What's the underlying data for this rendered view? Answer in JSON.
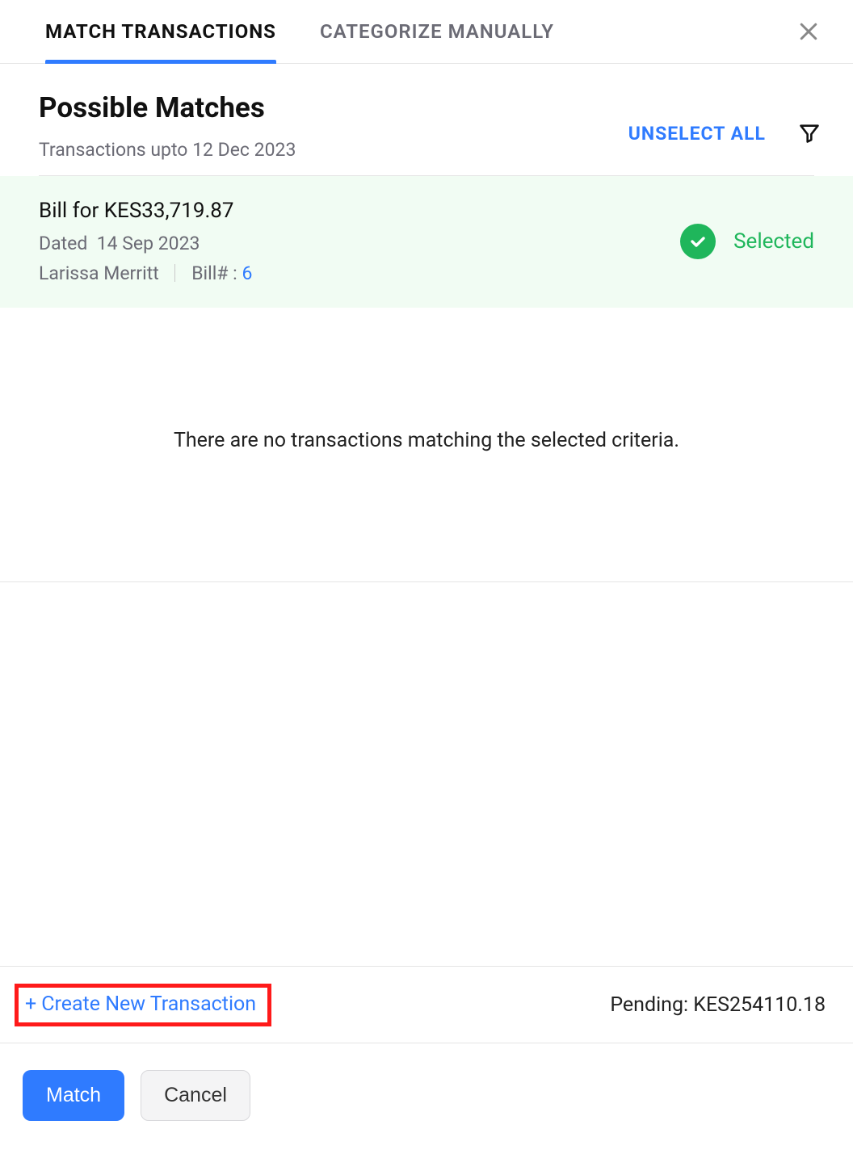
{
  "tabs": {
    "match": "MATCH TRANSACTIONS",
    "categorize": "CATEGORIZE MANUALLY"
  },
  "header": {
    "title": "Possible Matches",
    "subtitle": "Transactions upto 12 Dec 2023",
    "unselect_all": "UNSELECT ALL"
  },
  "match": {
    "title": "Bill   for KES33,719.87",
    "dated_label": "Dated",
    "dated_value": "14 Sep 2023",
    "customer": "Larissa Merritt",
    "bill_label": "Bill# :",
    "bill_number": "6",
    "selected_label": "Selected"
  },
  "empty_message": "There are no transactions matching the selected criteria.",
  "footer": {
    "create_plus": "+",
    "create_label": "Create New Transaction",
    "pending_text": "Pending: KES254110.18"
  },
  "actions": {
    "match": "Match",
    "cancel": "Cancel"
  }
}
